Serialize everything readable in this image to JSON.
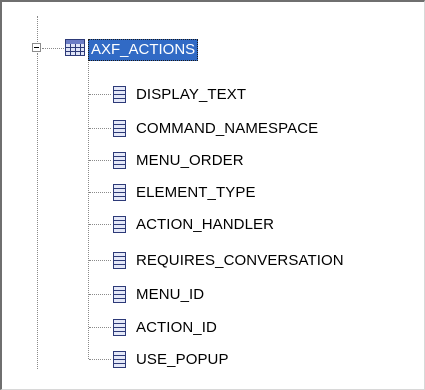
{
  "tree": {
    "root": {
      "label": "AXF_ACTIONS",
      "icon": "table-icon",
      "expanded": true,
      "selected": true
    },
    "columns": [
      {
        "label": "DISPLAY_TEXT",
        "icon": "column-icon"
      },
      {
        "label": "COMMAND_NAMESPACE",
        "icon": "column-icon"
      },
      {
        "label": "MENU_ORDER",
        "icon": "column-icon"
      },
      {
        "label": "ELEMENT_TYPE",
        "icon": "column-icon"
      },
      {
        "label": "ACTION_HANDLER",
        "icon": "column-icon"
      },
      {
        "label": "REQUIRES_CONVERSATION",
        "icon": "column-icon"
      },
      {
        "label": "MENU_ID",
        "icon": "column-icon"
      },
      {
        "label": "ACTION_ID",
        "icon": "column-icon"
      },
      {
        "label": "USE_POPUP",
        "icon": "column-icon"
      }
    ]
  },
  "colors": {
    "selection": "#316ac5",
    "selection_text": "#ffffff",
    "icon_border": "#2d3a78"
  }
}
